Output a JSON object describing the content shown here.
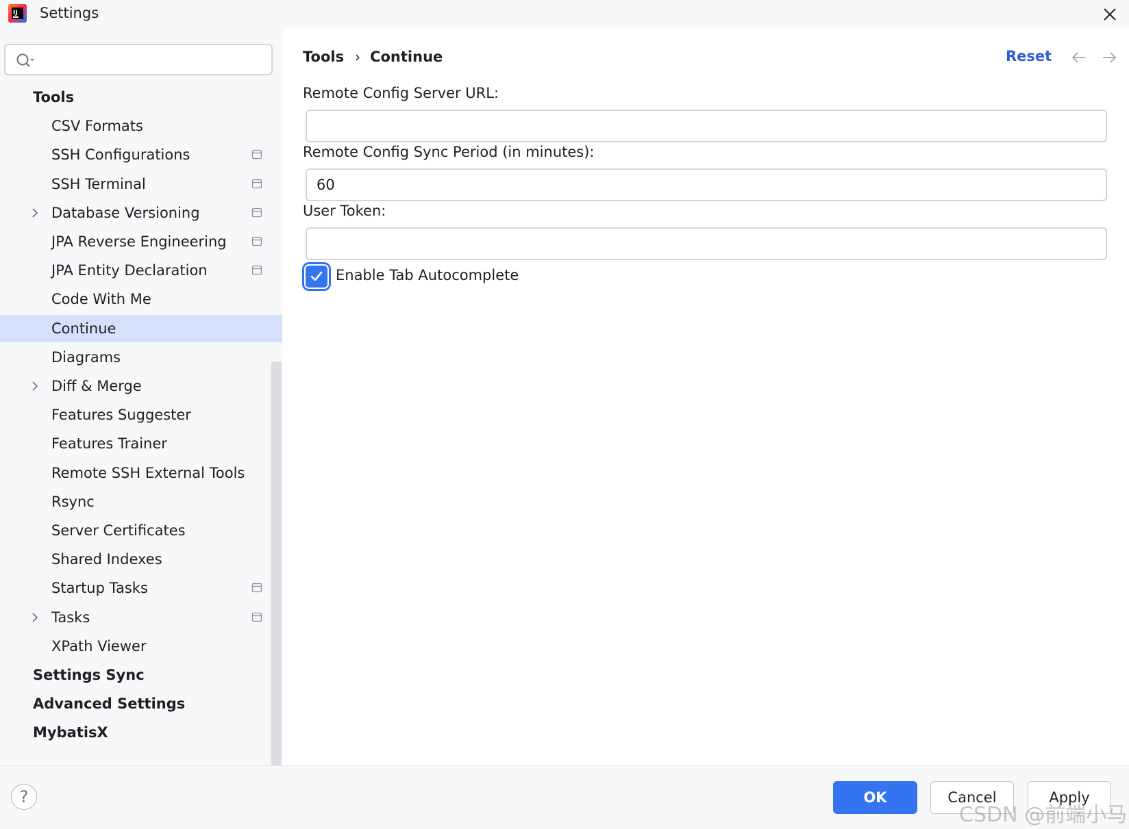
{
  "window": {
    "title": "Settings",
    "close_icon": "close-icon",
    "app_icon": "intellij-idea-icon"
  },
  "search": {
    "value": "",
    "placeholder": "",
    "icon": "search-icon"
  },
  "sidebar": {
    "items": [
      {
        "label": "Tools",
        "level": 0
      },
      {
        "label": "CSV Formats",
        "level": 1
      },
      {
        "label": "SSH Configurations",
        "level": 1,
        "project_icon": true
      },
      {
        "label": "SSH Terminal",
        "level": 1,
        "project_icon": true
      },
      {
        "label": "Database Versioning",
        "level": 1,
        "expandable": true,
        "project_icon": true
      },
      {
        "label": "JPA Reverse Engineering",
        "level": 1,
        "project_icon": true
      },
      {
        "label": "JPA Entity Declaration",
        "level": 1,
        "project_icon": true
      },
      {
        "label": "Code With Me",
        "level": 1
      },
      {
        "label": "Continue",
        "level": 1,
        "selected": true
      },
      {
        "label": "Diagrams",
        "level": 1
      },
      {
        "label": "Diff & Merge",
        "level": 1,
        "expandable": true
      },
      {
        "label": "Features Suggester",
        "level": 1
      },
      {
        "label": "Features Trainer",
        "level": 1
      },
      {
        "label": "Remote SSH External Tools",
        "level": 1
      },
      {
        "label": "Rsync",
        "level": 1
      },
      {
        "label": "Server Certificates",
        "level": 1
      },
      {
        "label": "Shared Indexes",
        "level": 1
      },
      {
        "label": "Startup Tasks",
        "level": 1,
        "project_icon": true
      },
      {
        "label": "Tasks",
        "level": 1,
        "expandable": true,
        "project_icon": true
      },
      {
        "label": "XPath Viewer",
        "level": 1
      },
      {
        "label": "Settings Sync",
        "level": 0
      },
      {
        "label": "Advanced Settings",
        "level": 0
      },
      {
        "label": "MybatisX",
        "level": 0
      }
    ]
  },
  "main": {
    "breadcrumb": [
      "Tools",
      "Continue"
    ],
    "breadcrumb_separator": "›",
    "reset_label": "Reset",
    "fields": [
      {
        "label": "Remote Config Server URL:",
        "value": ""
      },
      {
        "label": "Remote Config Sync Period (in minutes):",
        "value": "60"
      },
      {
        "label": "User Token:",
        "value": ""
      }
    ],
    "checkbox": {
      "label": "Enable Tab Autocomplete",
      "checked": true
    }
  },
  "footer": {
    "help_label": "?",
    "ok_label": "OK",
    "cancel_label": "Cancel",
    "apply_label": "Apply"
  },
  "watermark": "CSDN @前端小马",
  "colors": {
    "accent": "#3574f0",
    "link": "#2f5fd8",
    "selection": "#d5e1fc",
    "sidebar_bg": "#f7f8fa"
  }
}
